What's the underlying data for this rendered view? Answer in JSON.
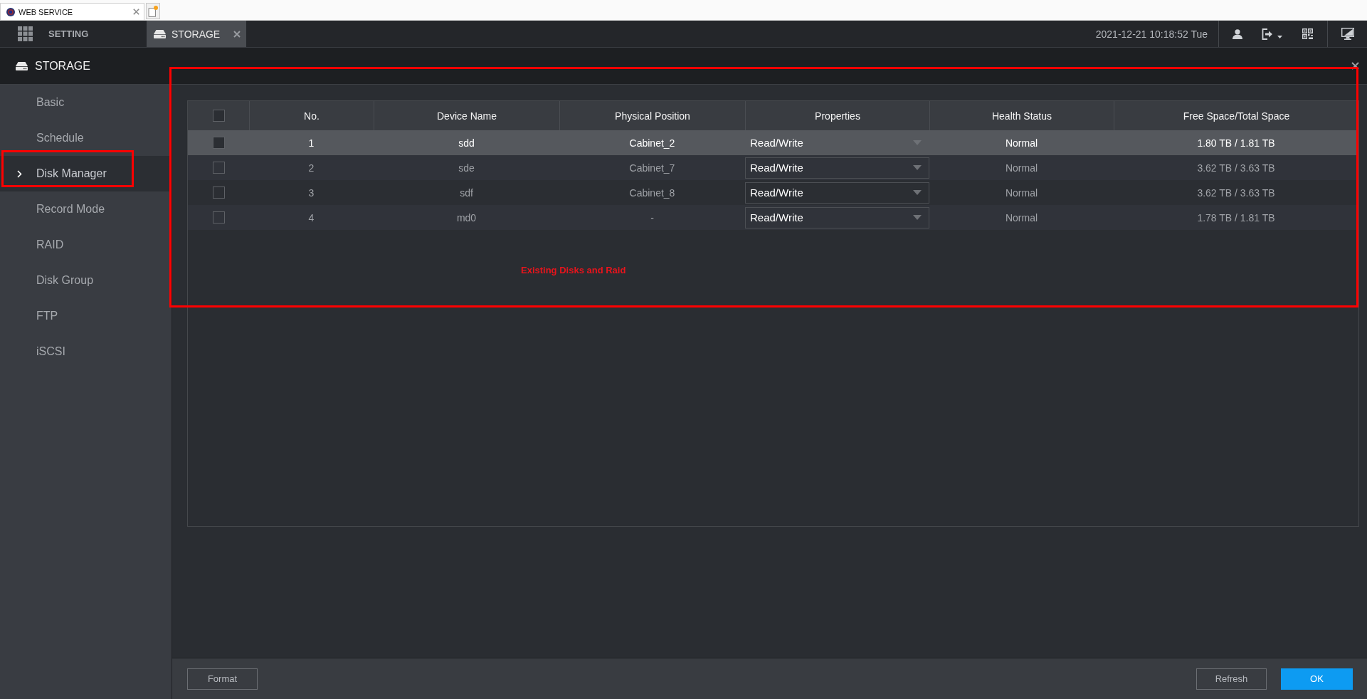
{
  "browser": {
    "tab": {
      "title": "WEB SERVICE"
    }
  },
  "top_bar": {
    "menu": {
      "label": "SETTING"
    },
    "tabs": [
      {
        "label": "STORAGE",
        "selected": true
      }
    ],
    "datetime": "2021-12-21 10:18:52 Tue"
  },
  "panel": {
    "title": "STORAGE"
  },
  "sidebar": {
    "items": [
      {
        "label": "Basic",
        "selected": false,
        "highlighted": false
      },
      {
        "label": "Schedule",
        "selected": false,
        "highlighted": false
      },
      {
        "label": "Disk Manager",
        "selected": true,
        "highlighted": true
      },
      {
        "label": "Record Mode",
        "selected": false,
        "highlighted": false
      },
      {
        "label": "RAID",
        "selected": false,
        "highlighted": false
      },
      {
        "label": "Disk Group",
        "selected": false,
        "highlighted": false
      },
      {
        "label": "FTP",
        "selected": false,
        "highlighted": false
      },
      {
        "label": "iSCSI",
        "selected": false,
        "highlighted": false
      }
    ]
  },
  "table": {
    "header_checked": false,
    "columns": [
      "No.",
      "Device Name",
      "Physical Position",
      "Properties",
      "Health Status",
      "Free Space/Total Space"
    ],
    "rows": [
      {
        "selected": true,
        "checked": false,
        "no": "1",
        "device_name": "sdd",
        "physical_position": "Cabinet_2",
        "properties": "Read/Write",
        "health_status": "Normal",
        "space": "1.80 TB / 1.81 TB"
      },
      {
        "selected": false,
        "checked": false,
        "no": "2",
        "device_name": "sde",
        "physical_position": "Cabinet_7",
        "properties": "Read/Write",
        "health_status": "Normal",
        "space": "3.62 TB / 3.63 TB"
      },
      {
        "selected": false,
        "checked": false,
        "no": "3",
        "device_name": "sdf",
        "physical_position": "Cabinet_8",
        "properties": "Read/Write",
        "health_status": "Normal",
        "space": "3.62 TB / 3.63 TB"
      },
      {
        "selected": false,
        "checked": false,
        "no": "4",
        "device_name": "md0",
        "physical_position": "-",
        "properties": "Read/Write",
        "health_status": "Normal",
        "space": "1.78 TB / 1.81 TB"
      }
    ],
    "annotation": "Existing Disks and Raid"
  },
  "footer": {
    "left_buttons": [
      {
        "label": "Format",
        "kind": "default"
      }
    ],
    "right_buttons": [
      {
        "label": "Refresh",
        "kind": "default"
      },
      {
        "label": "OK",
        "kind": "primary"
      }
    ]
  }
}
